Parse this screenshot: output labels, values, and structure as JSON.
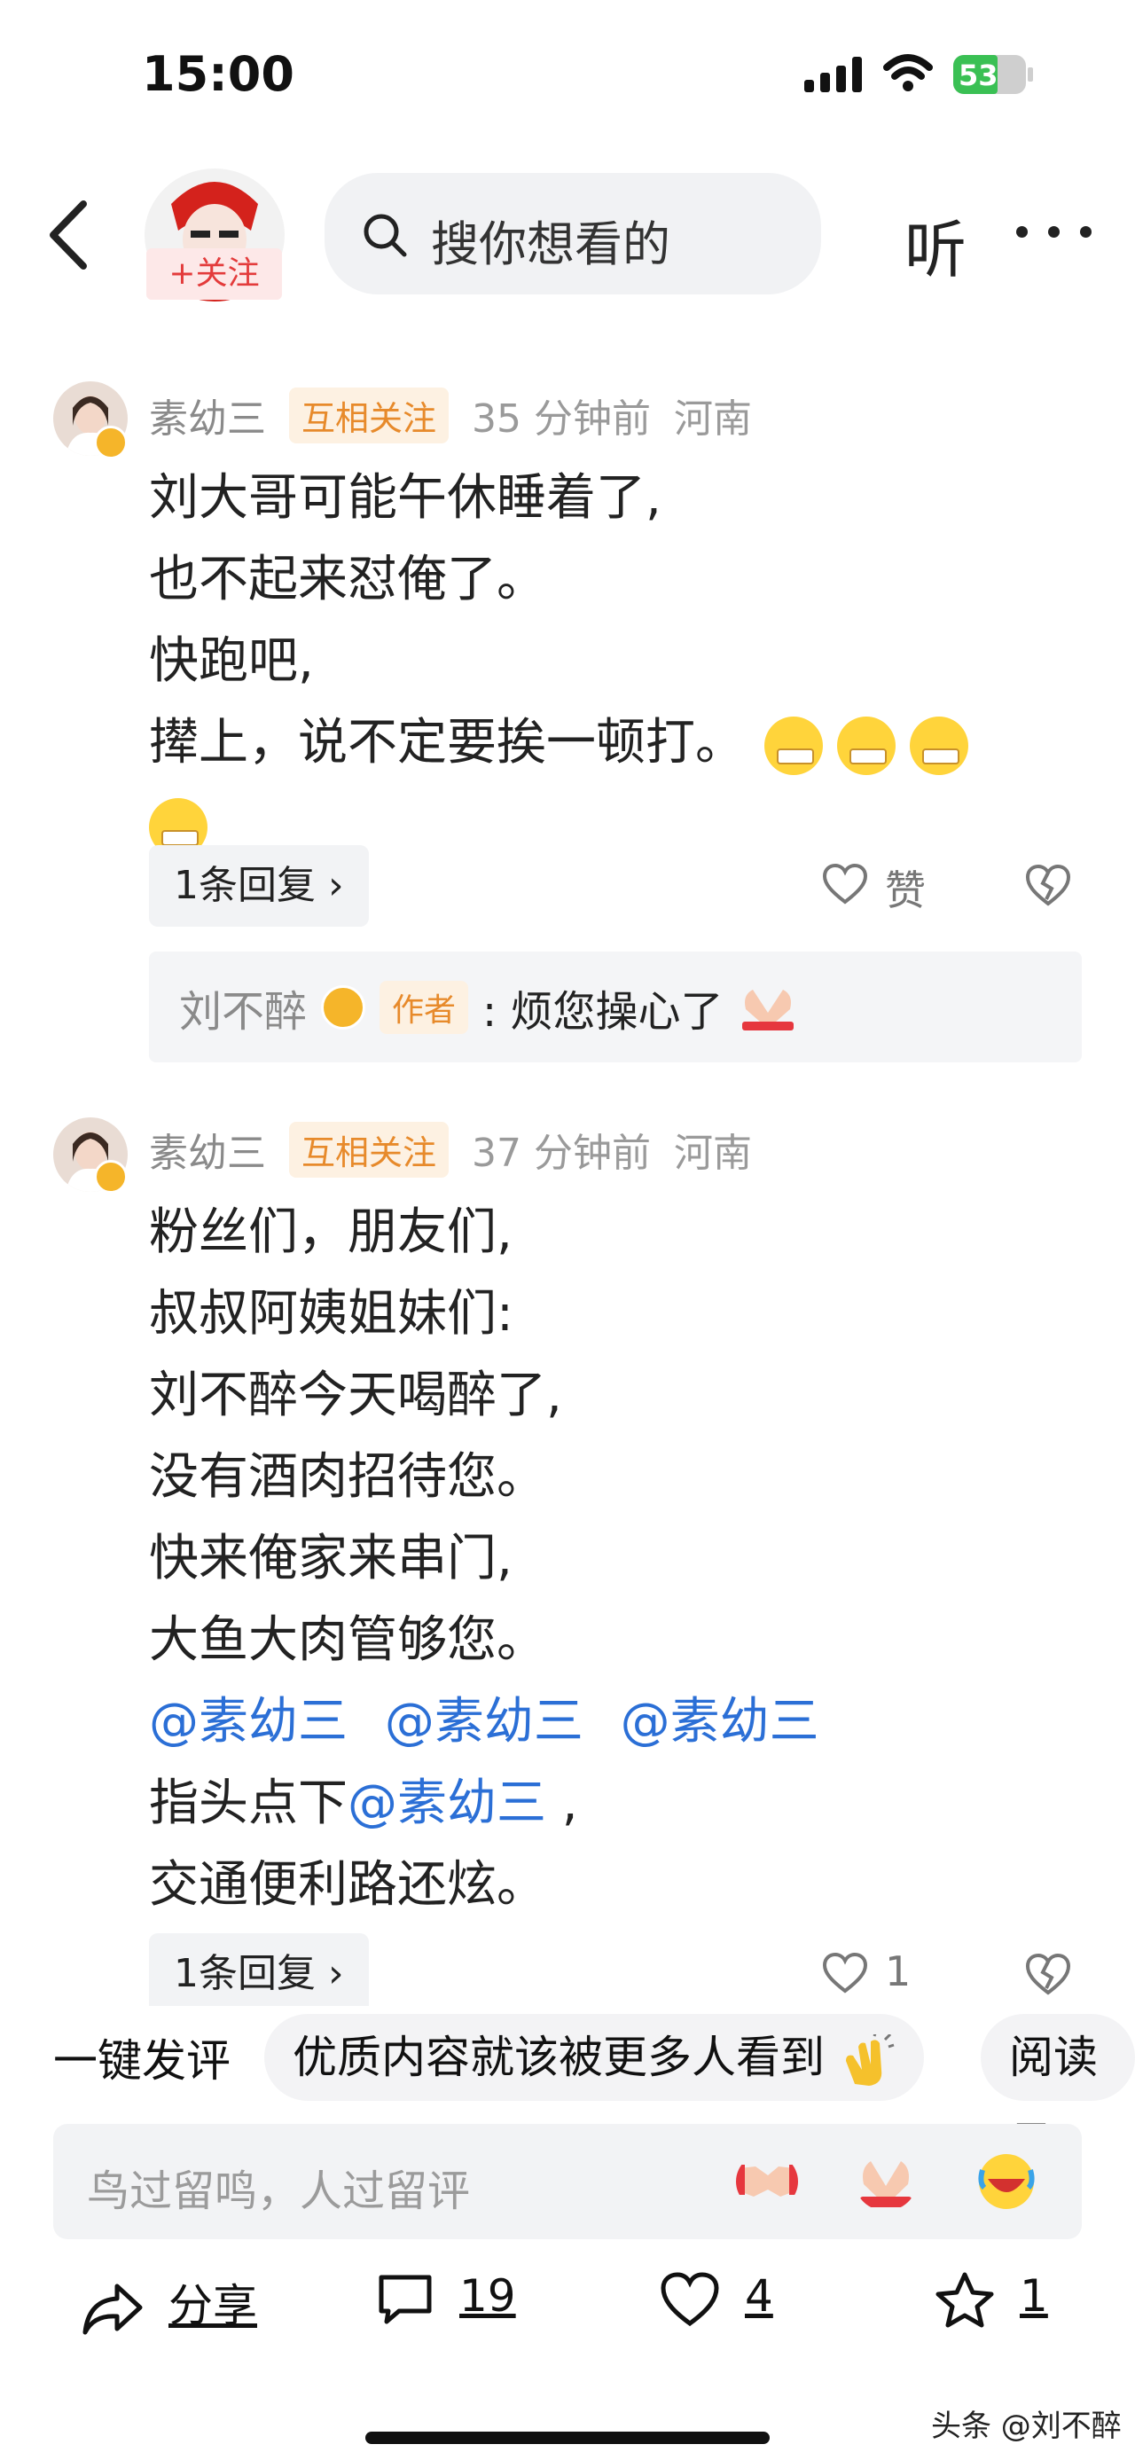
{
  "status_bar": {
    "time": "15:00",
    "battery": "53"
  },
  "header": {
    "follow_label": "+关注",
    "search_placeholder": "搜你想看的",
    "listen_label": "听"
  },
  "comments": [
    {
      "user": "素幼三",
      "relation": "互相关注",
      "time": "35 分钟前",
      "location": "河南",
      "lines": [
        "刘大哥可能午休睡着了,",
        "也不起来怼俺了。",
        "快跑吧,",
        "撵上，说不定要挨一顿打。"
      ],
      "reply_count_label": "1条回复",
      "like_label": "赞",
      "author_reply": {
        "user": "刘不醉",
        "tag": "作者",
        "text": ": 烦您操心了"
      }
    },
    {
      "user": "素幼三",
      "relation": "互相关注",
      "time": "37 分钟前",
      "location": "河南",
      "lines": [
        "粉丝们，朋友们,",
        "叔叔阿姨姐妹们:",
        "刘不醉今天喝醉了,",
        "没有酒肉招待您。",
        "快来俺家来串门,",
        "大鱼大肉管够您。"
      ],
      "mentions": [
        "@素幼三",
        "@素幼三",
        "@素幼三"
      ],
      "line_prefix": "指头点下",
      "line_mention": "@素幼三",
      "line_suffix": " ,",
      "last_line": "交通便利路还炫。",
      "reply_count_label": "1条回复",
      "like_count": "1"
    }
  ],
  "quick_comment": {
    "label": "一键发评",
    "chips": [
      "优质内容就该被更多人看到",
      "阅读量"
    ]
  },
  "input": {
    "placeholder": "鸟过留鸣，人过留评"
  },
  "actions": {
    "share": "分享",
    "comments": "19",
    "likes": "4",
    "favorites": "1"
  },
  "watermark": "头条 @刘不醉",
  "colors": {
    "accent_red": "#e33b3b",
    "mention_blue": "#2b6fd6",
    "tag_orange": "#e78a2b"
  }
}
